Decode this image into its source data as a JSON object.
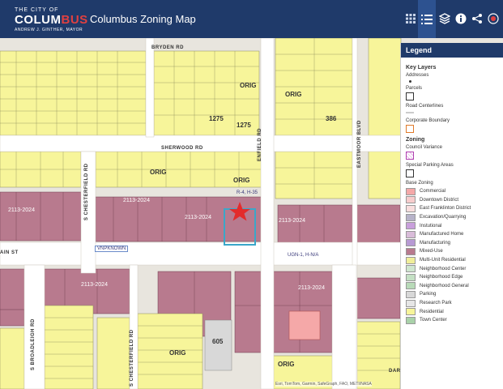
{
  "header": {
    "logo_small": "THE CITY OF",
    "logo_big_a": "COLUM",
    "logo_big_b": "BUS",
    "logo_tag": "ANDREW J. GINTHER, MAYOR",
    "title": "Columbus Zoning Map"
  },
  "toolbar": {
    "tools": [
      "grid-icon",
      "list-icon",
      "layers-icon",
      "info-icon",
      "share-icon"
    ]
  },
  "streets": {
    "bryden": "BRYDEN RD",
    "sherwood": "SHERWOOD RD",
    "main": "AIN ST",
    "enfield": "ENFIELD RD",
    "eastmoor": "EASTMOOR BLVD",
    "chesterfield_n": "S CHESTERFIELD RD",
    "chesterfield_s": "S CHESTERFIELD RD",
    "broadleigh": "S BROADLEIGH RD",
    "dar": "DAR"
  },
  "map_labels": {
    "orig_1": "ORIG",
    "orig_2": "ORIG",
    "orig_3": "ORIG",
    "orig_4": "ORIG",
    "orig_5": "ORIG",
    "orig_6": "ORIG",
    "parcel_1275a": "1275",
    "parcel_1275b": "1275",
    "parcel_386": "386",
    "parcel_605": "605",
    "z_2113_a": "2113-2024",
    "z_2113_b": "2113-2024",
    "z_2113_c": "2113-2024",
    "z_2113_d": "2113-2024",
    "z_2113_e": "2113-2024",
    "z_2113_f": "2113-2024",
    "ugn": "UGN-1, H-N/A",
    "r4": "R-4, H-35",
    "vnp": "VNPKNOWN"
  },
  "legend": {
    "title": "Legend",
    "key_layers": "Key Layers",
    "addresses": "Addresses",
    "parcels": "Parcels",
    "road_centerlines": "Road Centerlines",
    "corporate_boundary": "Corporate Boundary",
    "zoning": "Zoning",
    "council_variance": "Council Variance",
    "special_parking": "Special Parking Areas",
    "base_zoning": "Base Zoning",
    "zones": [
      {
        "label": "Commercial",
        "color": "#f5a8a8"
      },
      {
        "label": "Downtown District",
        "color": "#f7cccc"
      },
      {
        "label": "East Franklinton District",
        "color": "#f9dede"
      },
      {
        "label": "Excavation/Quarrying",
        "color": "#b7b3c9"
      },
      {
        "label": "Instutional",
        "color": "#c9a0dc"
      },
      {
        "label": "Manufactured Home",
        "color": "#d9bcd9"
      },
      {
        "label": "Manufacturing",
        "color": "#b79ad4"
      },
      {
        "label": "Mixed-Use",
        "color": "#b87a8e"
      },
      {
        "label": "Multi-Unit Residential",
        "color": "#f0ee9a"
      },
      {
        "label": "Neighborhood Center",
        "color": "#cfe6cf"
      },
      {
        "label": "Neighborhood Edge",
        "color": "#c4e0c4"
      },
      {
        "label": "Neighborhood General",
        "color": "#b8dab8"
      },
      {
        "label": "Parking",
        "color": "#d8d8d8"
      },
      {
        "label": "Research Park",
        "color": "#e6e6e6"
      },
      {
        "label": "Residential",
        "color": "#f7f59a"
      },
      {
        "label": "Town Center",
        "color": "#a9d2a9"
      }
    ]
  },
  "credit": "Esri, TomTom, Garmin, SafeGraph, FAO, METI/NASA"
}
